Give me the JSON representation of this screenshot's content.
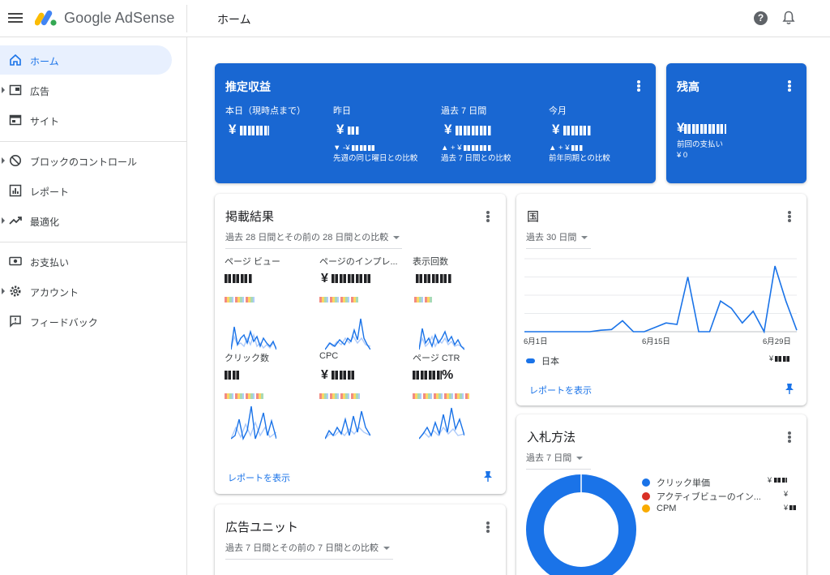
{
  "app": {
    "brand": "Google AdSense",
    "page_title": "ホーム"
  },
  "colors": {
    "primary_blue": "#1967d2",
    "link_blue": "#1a73e8",
    "active_nav_bg": "#e8f0fe",
    "bid_red": "#d93025",
    "bid_yellow": "#f9ab00"
  },
  "sidebar": {
    "items": [
      {
        "label": "ホーム",
        "icon": "home-icon",
        "active": true
      },
      {
        "label": "広告",
        "icon": "ads-icon",
        "expandable": true
      },
      {
        "label": "サイト",
        "icon": "sites-icon"
      },
      {
        "label": "ブロックのコントロール",
        "icon": "block-icon",
        "expandable": true
      },
      {
        "label": "レポート",
        "icon": "report-icon"
      },
      {
        "label": "最適化",
        "icon": "trending-up-icon",
        "expandable": true
      },
      {
        "label": "お支払い",
        "icon": "payments-icon"
      },
      {
        "label": "アカウント",
        "icon": "gear-icon",
        "expandable": true
      },
      {
        "label": "フィードバック",
        "icon": "feedback-icon"
      }
    ]
  },
  "estimated_earnings": {
    "title": "推定収益",
    "today": {
      "label": "本日（現時点まで）",
      "value": "¥"
    },
    "yesterday": {
      "label": "昨日",
      "value": "¥",
      "change": "▼ -¥",
      "comparison": "先週の同じ曜日との比較"
    },
    "last7": {
      "label": "過去 7 日間",
      "value": "¥",
      "change": "▲ + ¥",
      "comparison": "過去 7 日間との比較"
    },
    "this_month": {
      "label": "今月",
      "value": "¥",
      "change": "▲ + ¥",
      "comparison": "前年同期との比較"
    }
  },
  "balance": {
    "title": "残高",
    "value": "¥",
    "last_payment_label": "前回の支払い",
    "last_payment_value": "¥ 0"
  },
  "performance": {
    "title": "掲載結果",
    "range": "過去 28 日間とその前の 28 日間との比較",
    "metrics": [
      {
        "label": "ページ ビュー",
        "prefix": ""
      },
      {
        "label": "ページのインプレ...",
        "prefix": "¥"
      },
      {
        "label": "表示回数",
        "prefix": ""
      },
      {
        "label": "クリック数",
        "prefix": ""
      },
      {
        "label": "CPC",
        "prefix": "¥"
      },
      {
        "label": "ページ CTR",
        "prefix": "",
        "suffix": "%"
      }
    ],
    "link": "レポートを表示"
  },
  "countries": {
    "title": "国",
    "range": "過去 30 日間",
    "country_name": "日本",
    "country_value": "¥",
    "link": "レポートを表示"
  },
  "ad_units": {
    "title": "広告ユニット",
    "range": "過去 7 日間とその前の 7 日間との比較"
  },
  "bid_types": {
    "title": "入札方法",
    "range": "過去 7 日間",
    "items": [
      {
        "label": "クリック単価",
        "value": "¥",
        "color": "#1a73e8"
      },
      {
        "label": "アクティブビューのイン...",
        "value": "¥",
        "color": "#d93025"
      },
      {
        "label": "CPM",
        "value": "¥",
        "color": "#f9ab00"
      }
    ]
  },
  "chart_data": {
    "type": "line",
    "x_tick_labels": [
      "6月1日",
      "6月15日",
      "6月29日"
    ],
    "series": [
      {
        "name": "日本",
        "values": [
          0,
          0,
          0,
          0,
          0,
          0,
          0,
          0.02,
          0.03,
          0.15,
          0,
          0,
          0.06,
          0.12,
          0.1,
          0.75,
          0,
          0,
          0.42,
          0.32,
          0.12,
          0.28,
          0,
          0.9,
          0.42,
          0.02
        ]
      }
    ]
  }
}
